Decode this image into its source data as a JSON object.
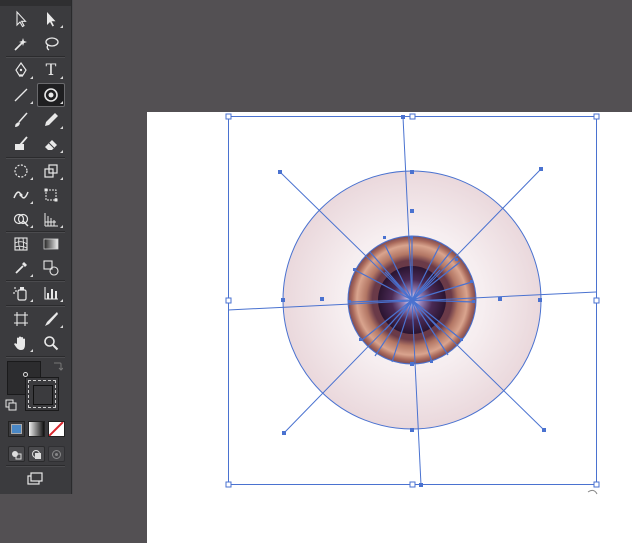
{
  "toolbar": {
    "tools": [
      {
        "id": "selection",
        "icon": "selection-arrow-icon"
      },
      {
        "id": "direct-selection",
        "icon": "direct-selection-arrow-icon"
      },
      {
        "id": "magic-wand",
        "icon": "magic-wand-icon"
      },
      {
        "id": "lasso",
        "icon": "lasso-icon"
      },
      {
        "id": "pen",
        "icon": "pen-icon"
      },
      {
        "id": "type",
        "icon": "type-icon",
        "label": "T"
      },
      {
        "id": "line-segment",
        "icon": "line-segment-icon"
      },
      {
        "id": "flare",
        "icon": "flare-icon",
        "active": true
      },
      {
        "id": "paintbrush",
        "icon": "paintbrush-icon"
      },
      {
        "id": "pencil",
        "icon": "pencil-icon"
      },
      {
        "id": "blob-brush",
        "icon": "blob-brush-icon"
      },
      {
        "id": "eraser",
        "icon": "eraser-icon"
      },
      {
        "id": "rotate",
        "icon": "rotate-icon"
      },
      {
        "id": "scale",
        "icon": "scale-icon"
      },
      {
        "id": "width",
        "icon": "width-tool-icon"
      },
      {
        "id": "free-transform",
        "icon": "free-transform-icon"
      },
      {
        "id": "shape-builder",
        "icon": "shape-builder-icon"
      },
      {
        "id": "perspective-grid",
        "icon": "perspective-grid-icon"
      },
      {
        "id": "mesh",
        "icon": "mesh-icon"
      },
      {
        "id": "gradient",
        "icon": "gradient-icon"
      },
      {
        "id": "eyedropper",
        "icon": "eyedropper-icon"
      },
      {
        "id": "blend",
        "icon": "blend-icon"
      },
      {
        "id": "symbol-sprayer",
        "icon": "symbol-sprayer-icon"
      },
      {
        "id": "column-graph",
        "icon": "column-graph-icon"
      },
      {
        "id": "artboard",
        "icon": "artboard-icon"
      },
      {
        "id": "slice",
        "icon": "slice-icon"
      },
      {
        "id": "hand",
        "icon": "hand-icon"
      },
      {
        "id": "zoom",
        "icon": "zoom-icon"
      }
    ],
    "swatch_icons": [
      "swap-fill-stroke-icon",
      "default-fill-stroke-icon"
    ],
    "color_modes": [
      "color-mode-icon",
      "gradient-mode-icon",
      "none-mode-icon"
    ],
    "draw_modes": [
      "draw-normal-icon",
      "draw-behind-icon",
      "draw-inside-icon"
    ],
    "screen_mode": "change-screen-mode-icon",
    "colors": {
      "panel": "#3b3b3e",
      "workspace": "#535053",
      "accent_red": "#d9282f"
    }
  },
  "canvas": {
    "selection_color": "#4a72d0",
    "flare": {
      "halo_color": "#f0e4e6",
      "ring_color": "#b07868",
      "center_color": "#4a2440"
    }
  }
}
